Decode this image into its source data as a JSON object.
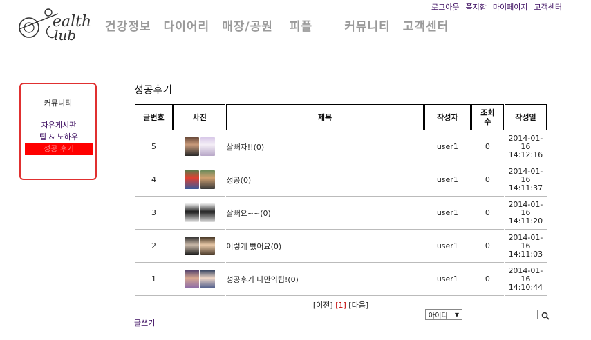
{
  "top_links": [
    "로그아웃",
    "쪽지함",
    "마이페이지",
    "고객센터"
  ],
  "logo": {
    "icon": "health-club-logo-icon",
    "text": "Health Club"
  },
  "main_nav": [
    "건강정보",
    "다이어리",
    "매장/공원",
    "피플",
    "커뮤니티",
    "고객센터"
  ],
  "side_menu": {
    "title": "커뮤니티",
    "items": [
      "자유게시판",
      "팁 & 노하우",
      "성공 후기"
    ],
    "active_index": 2
  },
  "page_title": "성공후기",
  "board": {
    "headers": [
      "글번호",
      "사진",
      "제목",
      "작성자",
      "조회\n수",
      "작성일"
    ],
    "rows": [
      {
        "no": "5",
        "title": "살빼자!!(0)",
        "author": "user1",
        "views": "0",
        "date": "2014-01-16",
        "time": "14:12:16"
      },
      {
        "no": "4",
        "title": "성공(0)",
        "author": "user1",
        "views": "0",
        "date": "2014-01-16",
        "time": "14:11:37"
      },
      {
        "no": "3",
        "title": "살빼요~~(0)",
        "author": "user1",
        "views": "0",
        "date": "2014-01-16",
        "time": "14:11:20"
      },
      {
        "no": "2",
        "title": "이렇게 뺐어요(0)",
        "author": "user1",
        "views": "0",
        "date": "2014-01-16",
        "time": "14:11:03"
      },
      {
        "no": "1",
        "title": "성공후기 나만의팁!(0)",
        "author": "user1",
        "views": "0",
        "date": "2014-01-16",
        "time": "14:10:44"
      }
    ]
  },
  "pager": {
    "prev": "[이전]",
    "current": "[1]",
    "next": "[다음]"
  },
  "write_link": "글쓰기",
  "search": {
    "select_value": "아이디",
    "input_value": "",
    "button_icon": "search-icon"
  },
  "colors": {
    "accent_red": "#ff0000",
    "link_purple": "#3a0a5e",
    "nav_gray": "#9a9a9a"
  }
}
